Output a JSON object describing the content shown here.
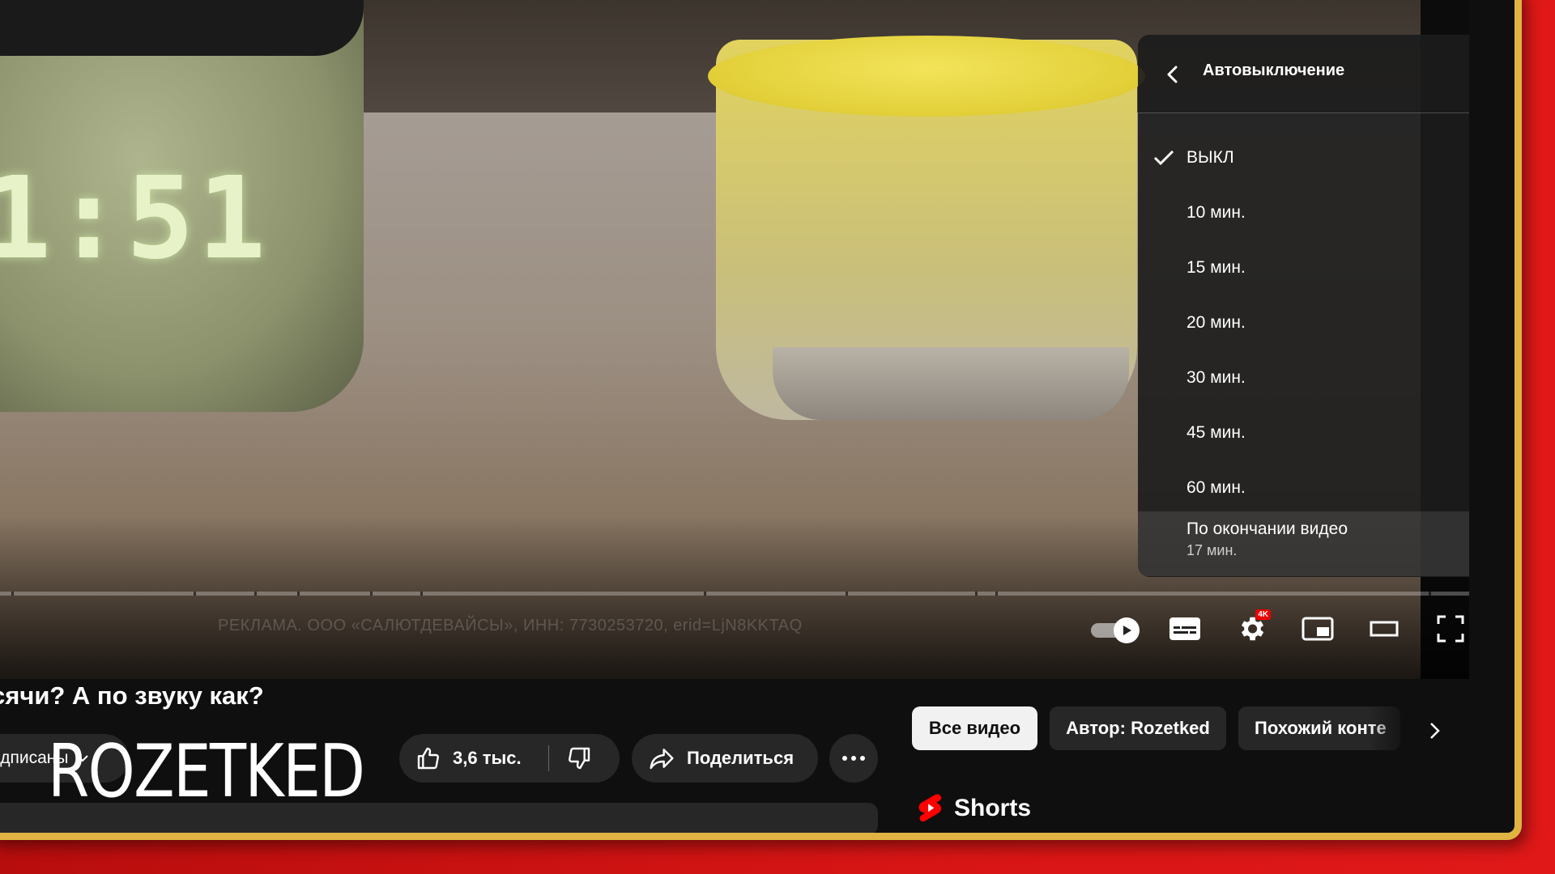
{
  "player": {
    "clock_display": "1:51",
    "ad_notice": "РЕКЛАМА. ООО «САЛЮТДЕВАЙСЫ», ИНН: 7730253720, erid=LjN8KKTAQ",
    "badge_4k": "4K"
  },
  "settings_panel": {
    "title": "Автовыключение",
    "options": [
      {
        "label": "ВЫКЛ",
        "selected": true
      },
      {
        "label": "10 мин."
      },
      {
        "label": "15 мин."
      },
      {
        "label": "20 мин."
      },
      {
        "label": "30 мин."
      },
      {
        "label": "45 мин."
      },
      {
        "label": "60 мин."
      },
      {
        "label": "По окончании видео",
        "sub": "17 мин."
      }
    ]
  },
  "video": {
    "title": "сячи? А по звуку как?",
    "subscribed_label": "одписаны",
    "logo_text": "ROZETKED",
    "likes": "3,6 тыс.",
    "share_label": "Поделиться"
  },
  "chips": {
    "all_videos": "Все видео",
    "author": "Автор: Rozetked",
    "similar": "Похожий конте"
  },
  "shorts": {
    "label": "Shorts"
  },
  "colors": {
    "accent_red": "#ff0000",
    "frame_gold": "#e0b442",
    "bg_red": "#cc1111"
  }
}
